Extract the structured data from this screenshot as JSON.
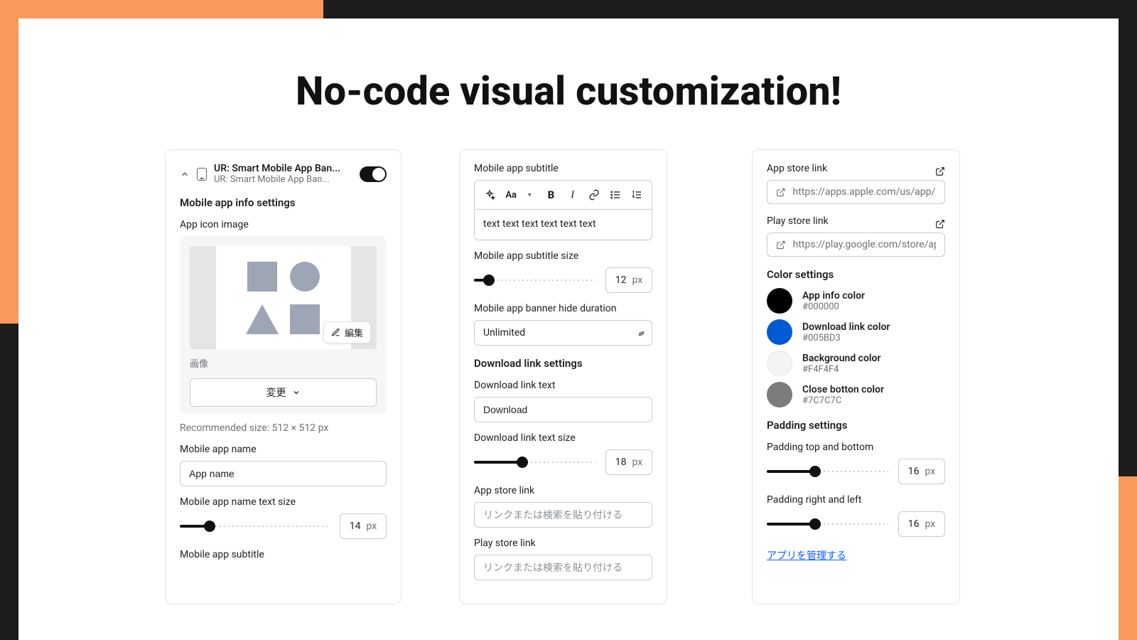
{
  "headline": "No-code visual customization!",
  "panel1": {
    "item_title": "UR: Smart Mobile App Ban...",
    "item_sub": "UR: Smart Mobile App Ban...",
    "section_info": "Mobile app info settings",
    "app_icon_label": "App icon image",
    "edit_label": "編集",
    "image_caption": "画像",
    "change_label": "変更",
    "rec_size": "Recommended size: 512 × 512 px",
    "name_label": "Mobile app name",
    "name_value": "App name",
    "name_size_label": "Mobile app name text size",
    "name_size_value": "14",
    "unit": "px",
    "subtitle_label": "Mobile app subtitle"
  },
  "panel2": {
    "subtitle_label": "Mobile app subtitle",
    "subtitle_text": "text text text text text text",
    "subtitle_size_label": "Mobile app subtitle size",
    "subtitle_size_value": "12",
    "hide_label": "Mobile app banner hide duration",
    "hide_value": "Unlimited",
    "download_section": "Download link settings",
    "dl_text_label": "Download link text",
    "dl_text_value": "Download",
    "dl_size_label": "Download link text size",
    "dl_size_value": "18",
    "app_store_label": "App store link",
    "play_store_label": "Play store link",
    "link_placeholder": "リンクまたは検索を貼り付ける",
    "unit": "px"
  },
  "panel3": {
    "app_store_label": "App store link",
    "app_store_url": "https://apps.apple.com/us/app/shc",
    "play_store_label": "Play store link",
    "play_store_url": "https://play.google.com/store/apps",
    "color_section": "Color settings",
    "colors": {
      "info": {
        "name": "App info color",
        "hex": "#000000"
      },
      "dl": {
        "name": "Download link color",
        "hex": "#005BD3"
      },
      "bg": {
        "name": "Background color",
        "hex": "#F4F4F4"
      },
      "close": {
        "name": "Close botton color",
        "hex": "#7C7C7C"
      }
    },
    "padding_section": "Padding settings",
    "pad_tb_label": "Padding top and bottom",
    "pad_tb_value": "16",
    "pad_rl_label": "Padding right and left",
    "pad_rl_value": "16",
    "unit": "px",
    "manage_link": "アプリを管理する"
  }
}
